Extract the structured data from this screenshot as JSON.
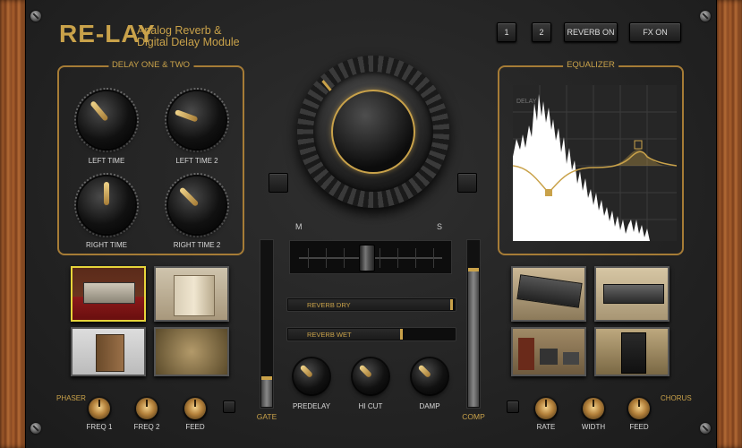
{
  "header": {
    "brand": "RE-LAY",
    "subtitle_line1": "Analog Reverb &",
    "subtitle_line2": "Digital Delay Module"
  },
  "top_buttons": {
    "preset1": "1",
    "preset2": "2",
    "reverb_on": "REVERB ON",
    "fx_on": "FX ON"
  },
  "delay_section": {
    "title": "DELAY ONE & TWO",
    "knobs": [
      "LEFT TIME",
      "LEFT TIME 2",
      "RIGHT TIME",
      "RIGHT TIME 2"
    ]
  },
  "equalizer": {
    "title": "EQUALIZER",
    "axis_label": "DELAY"
  },
  "mid_side": {
    "m_label": "M",
    "s_label": "S"
  },
  "reverb_sliders": {
    "dry_label": "REVERB DRY",
    "dry_value": 0.98,
    "wet_label": "REVERB WET",
    "wet_value": 0.68
  },
  "faders": {
    "gate_label": "GATE",
    "gate_value": 0.18,
    "comp_label": "COMP",
    "comp_value": 0.83
  },
  "reverb_knobs": [
    "PREDELAY",
    "HI CUT",
    "DAMP"
  ],
  "phaser": {
    "title": "PHASER",
    "knobs": [
      "FREQ 1",
      "FREQ 2",
      "FEED"
    ]
  },
  "chorus": {
    "title": "CHORUS",
    "knobs": [
      "RATE",
      "WIDTH",
      "FEED"
    ]
  },
  "colors": {
    "accent": "#c9a24a",
    "selected": "#e6d43a",
    "panel": "#262626"
  }
}
